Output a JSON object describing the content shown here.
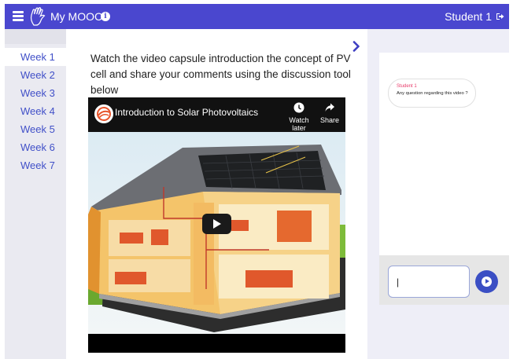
{
  "header": {
    "app_title": "My MOOC",
    "user_name": "Student 1",
    "brand_color": "#4a47cf"
  },
  "sidebar": {
    "items": [
      {
        "label": "Week 1",
        "active": true
      },
      {
        "label": "Week 2"
      },
      {
        "label": "Week 3"
      },
      {
        "label": "Week 4"
      },
      {
        "label": "Week 5"
      },
      {
        "label": "Week 6"
      },
      {
        "label": "Week 7"
      }
    ]
  },
  "main": {
    "instructions": "Watch the video capsule introduction the concept of PV cell and share your comments using the discussion tool below"
  },
  "video": {
    "title": "Introduction to Solar Photovoltaics",
    "watch_later_label": "Watch later",
    "share_label": "Share"
  },
  "chat": {
    "messages": [
      {
        "author": "Student 1",
        "text": "Any question regarding this video ?"
      }
    ],
    "input_value": "|",
    "author_color": "#e83a6a",
    "send_color": "#3b4fc4"
  }
}
